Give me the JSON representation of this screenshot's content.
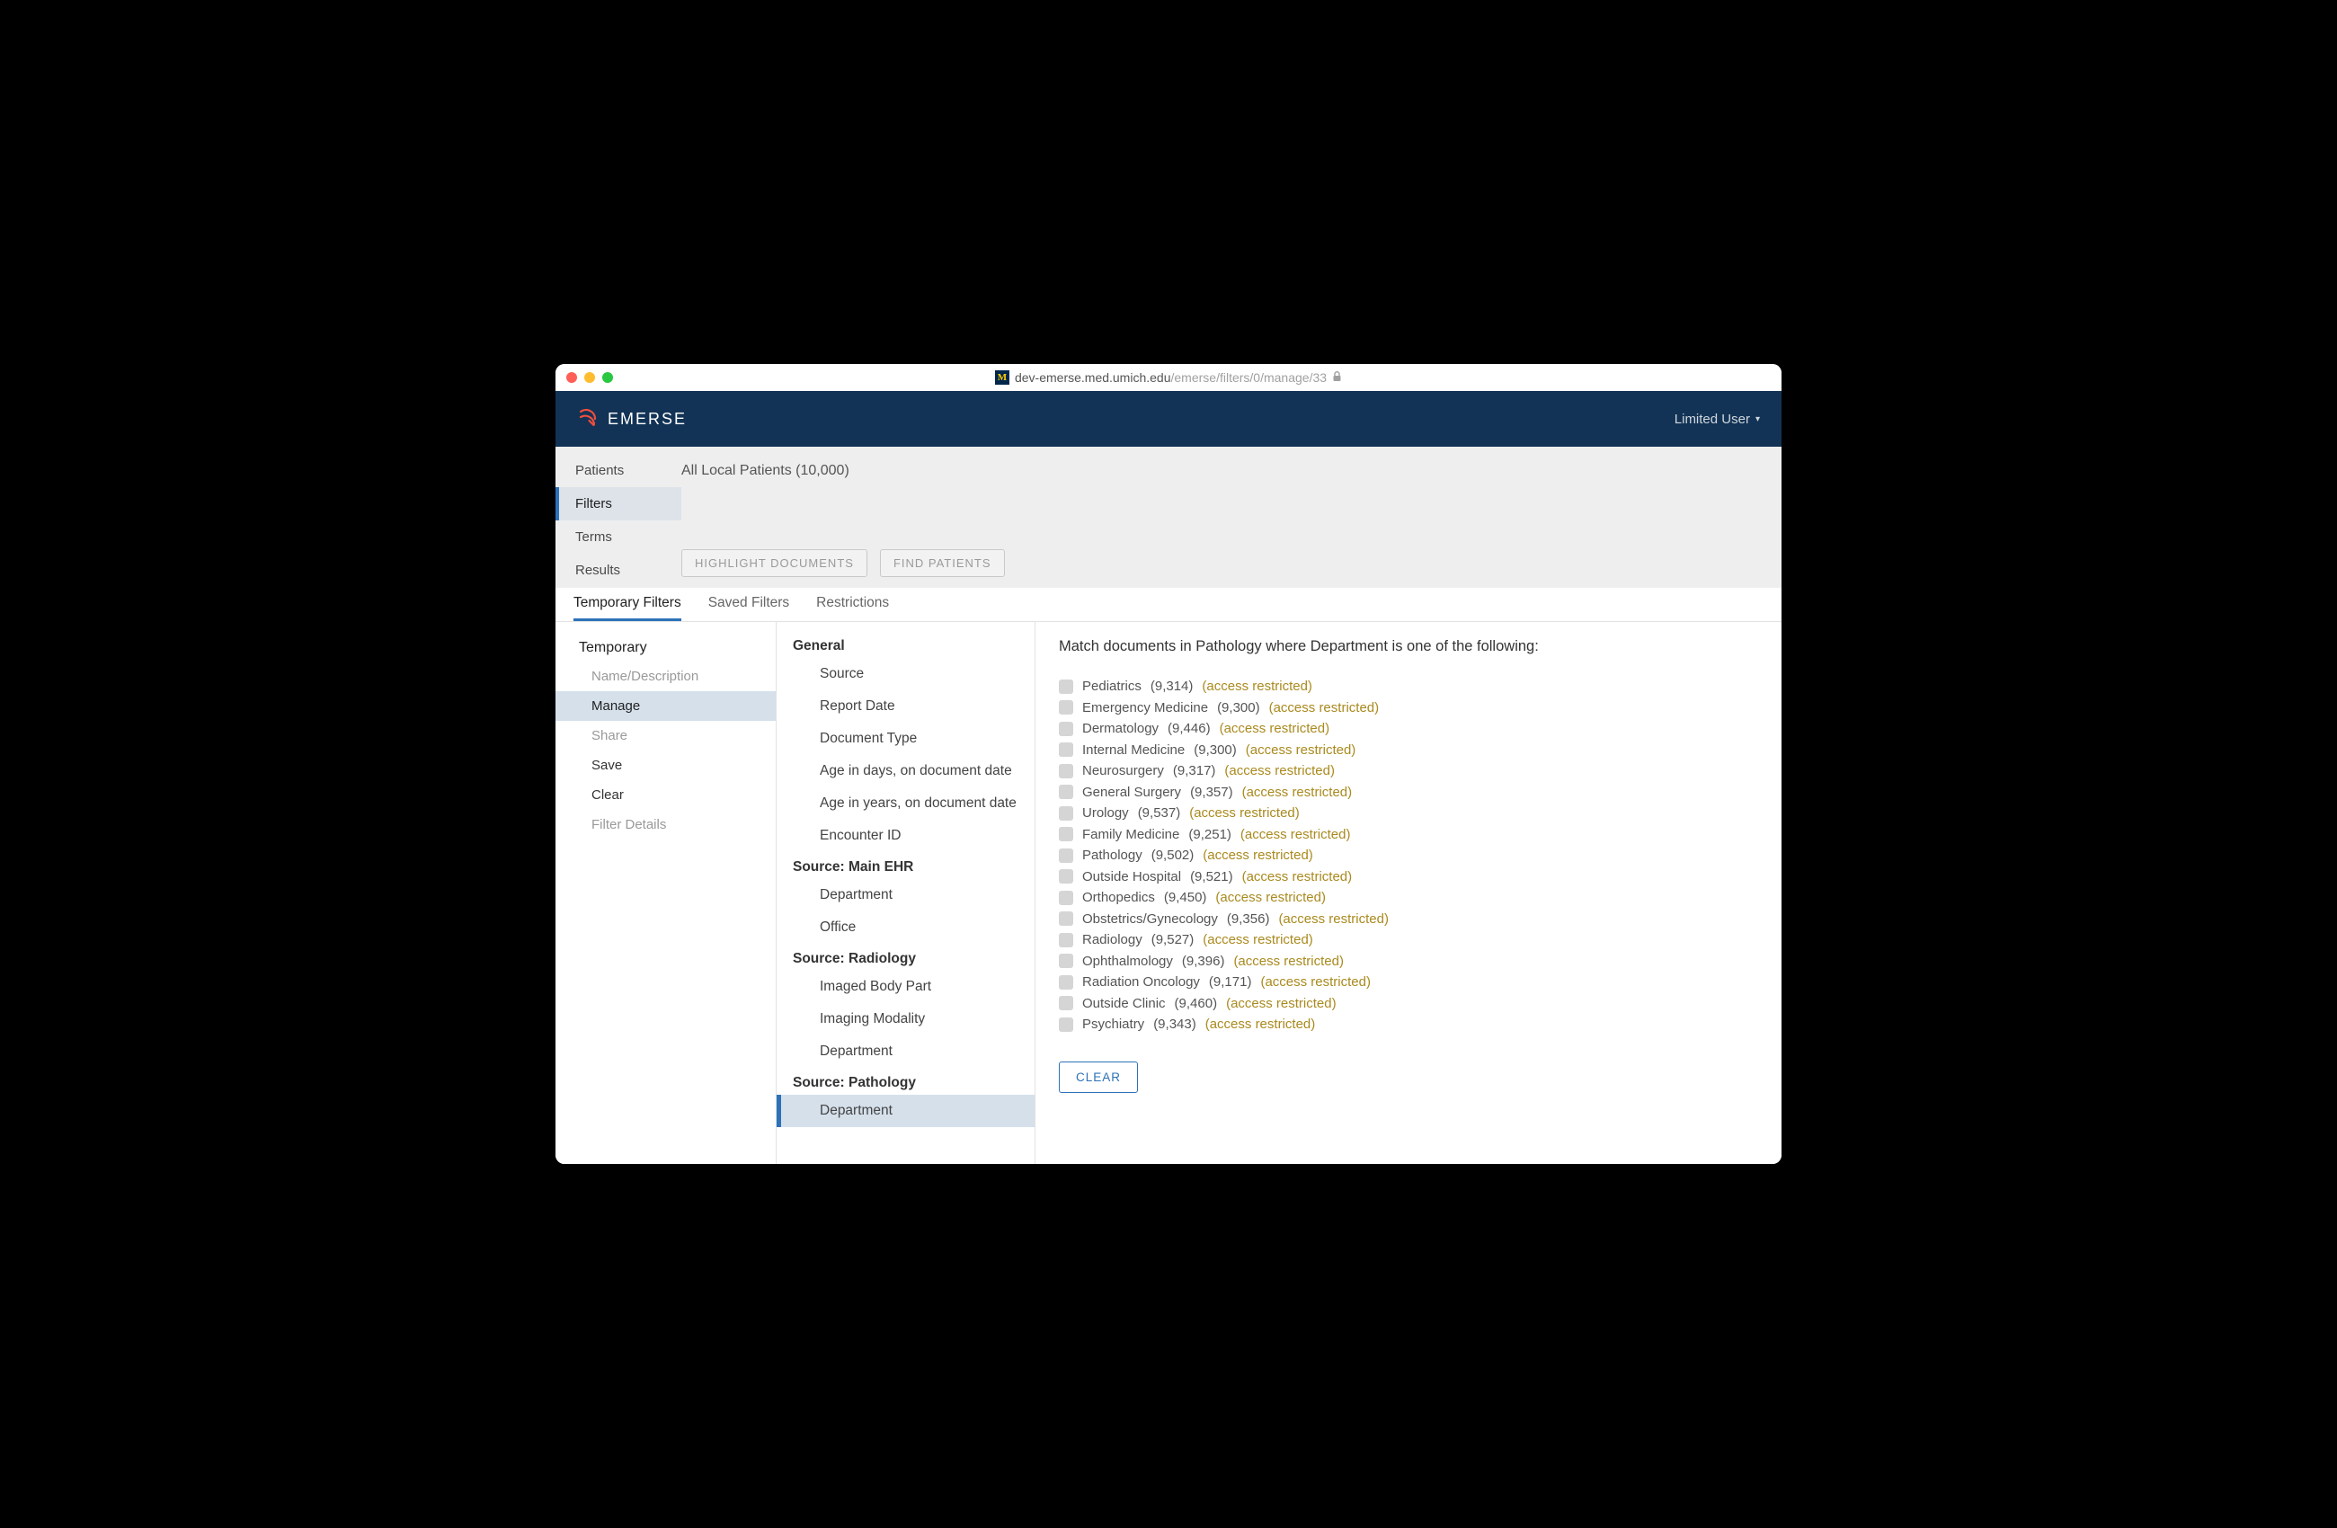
{
  "browser": {
    "url_host": "dev-emerse.med.umich.edu",
    "url_path": "/emerse/filters/0/manage/33"
  },
  "header": {
    "app_name": "EMERSE",
    "user_label": "Limited User"
  },
  "left_tabs": [
    {
      "label": "Patients",
      "active": false
    },
    {
      "label": "Filters",
      "active": true
    },
    {
      "label": "Terms",
      "active": false
    },
    {
      "label": "Results",
      "active": false
    }
  ],
  "patients_line": "All Local Patients (10,000)",
  "action_buttons": {
    "highlight": "HIGHLIGHT DOCUMENTS",
    "find": "FIND PATIENTS"
  },
  "strip_tabs": [
    {
      "label": "Temporary Filters",
      "active": true
    },
    {
      "label": "Saved Filters",
      "active": false
    },
    {
      "label": "Restrictions",
      "active": false
    }
  ],
  "col1": {
    "header": "Temporary",
    "items": [
      {
        "label": "Name/Description",
        "enabled": false,
        "active": false
      },
      {
        "label": "Manage",
        "enabled": true,
        "active": true
      },
      {
        "label": "Share",
        "enabled": false,
        "active": false
      },
      {
        "label": "Save",
        "enabled": true,
        "active": false
      },
      {
        "label": "Clear",
        "enabled": true,
        "active": false
      },
      {
        "label": "Filter Details",
        "enabled": false,
        "active": false
      }
    ]
  },
  "col2": [
    {
      "group": "General",
      "items": [
        "Source",
        "Report Date",
        "Document Type",
        "Age in days, on document date",
        "Age in years, on document date",
        "Encounter ID"
      ]
    },
    {
      "group": "Source: Main EHR",
      "items": [
        "Department",
        "Office"
      ]
    },
    {
      "group": "Source: Radiology",
      "items": [
        "Imaged Body Part",
        "Imaging Modality",
        "Department"
      ]
    },
    {
      "group": "Source: Pathology",
      "items": [
        "Department"
      ],
      "active_index": 0
    }
  ],
  "col3": {
    "match_line": "Match documents in Pathology where Department is one of the following:",
    "restricted_label": "(access restricted)",
    "clear_label": "CLEAR",
    "options": [
      {
        "name": "Pediatrics",
        "count": "(9,314)"
      },
      {
        "name": "Emergency Medicine",
        "count": "(9,300)"
      },
      {
        "name": "Dermatology",
        "count": "(9,446)"
      },
      {
        "name": "Internal Medicine",
        "count": "(9,300)"
      },
      {
        "name": "Neurosurgery",
        "count": "(9,317)"
      },
      {
        "name": "General Surgery",
        "count": "(9,357)"
      },
      {
        "name": "Urology",
        "count": "(9,537)"
      },
      {
        "name": "Family Medicine",
        "count": "(9,251)"
      },
      {
        "name": "Pathology",
        "count": "(9,502)"
      },
      {
        "name": "Outside Hospital",
        "count": "(9,521)"
      },
      {
        "name": "Orthopedics",
        "count": "(9,450)"
      },
      {
        "name": "Obstetrics/Gynecology",
        "count": "(9,356)"
      },
      {
        "name": "Radiology",
        "count": "(9,527)"
      },
      {
        "name": "Ophthalmology",
        "count": "(9,396)"
      },
      {
        "name": "Radiation Oncology",
        "count": "(9,171)"
      },
      {
        "name": "Outside Clinic",
        "count": "(9,460)"
      },
      {
        "name": "Psychiatry",
        "count": "(9,343)"
      }
    ]
  }
}
